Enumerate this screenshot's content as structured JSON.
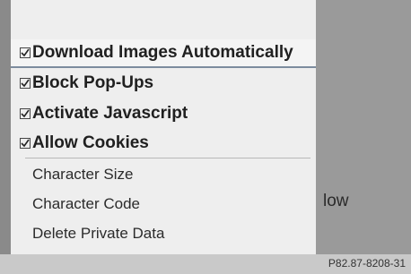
{
  "menu": {
    "checked_items": [
      {
        "label": "Download Images Automatically"
      },
      {
        "label": "Block Pop-Ups"
      },
      {
        "label": "Activate Javascript"
      },
      {
        "label": "Allow Cookies"
      }
    ],
    "plain_items": [
      {
        "label": "Character Size"
      },
      {
        "label": "Character Code"
      },
      {
        "label": "Delete Private Data"
      }
    ]
  },
  "background": {
    "partial_text": "low"
  },
  "footer": {
    "code": "P82.87-8208-31"
  },
  "colors": {
    "menu_bg": "#eeeeee",
    "highlight": "#7c8c9e",
    "page_bg": "#8e8e8e"
  }
}
